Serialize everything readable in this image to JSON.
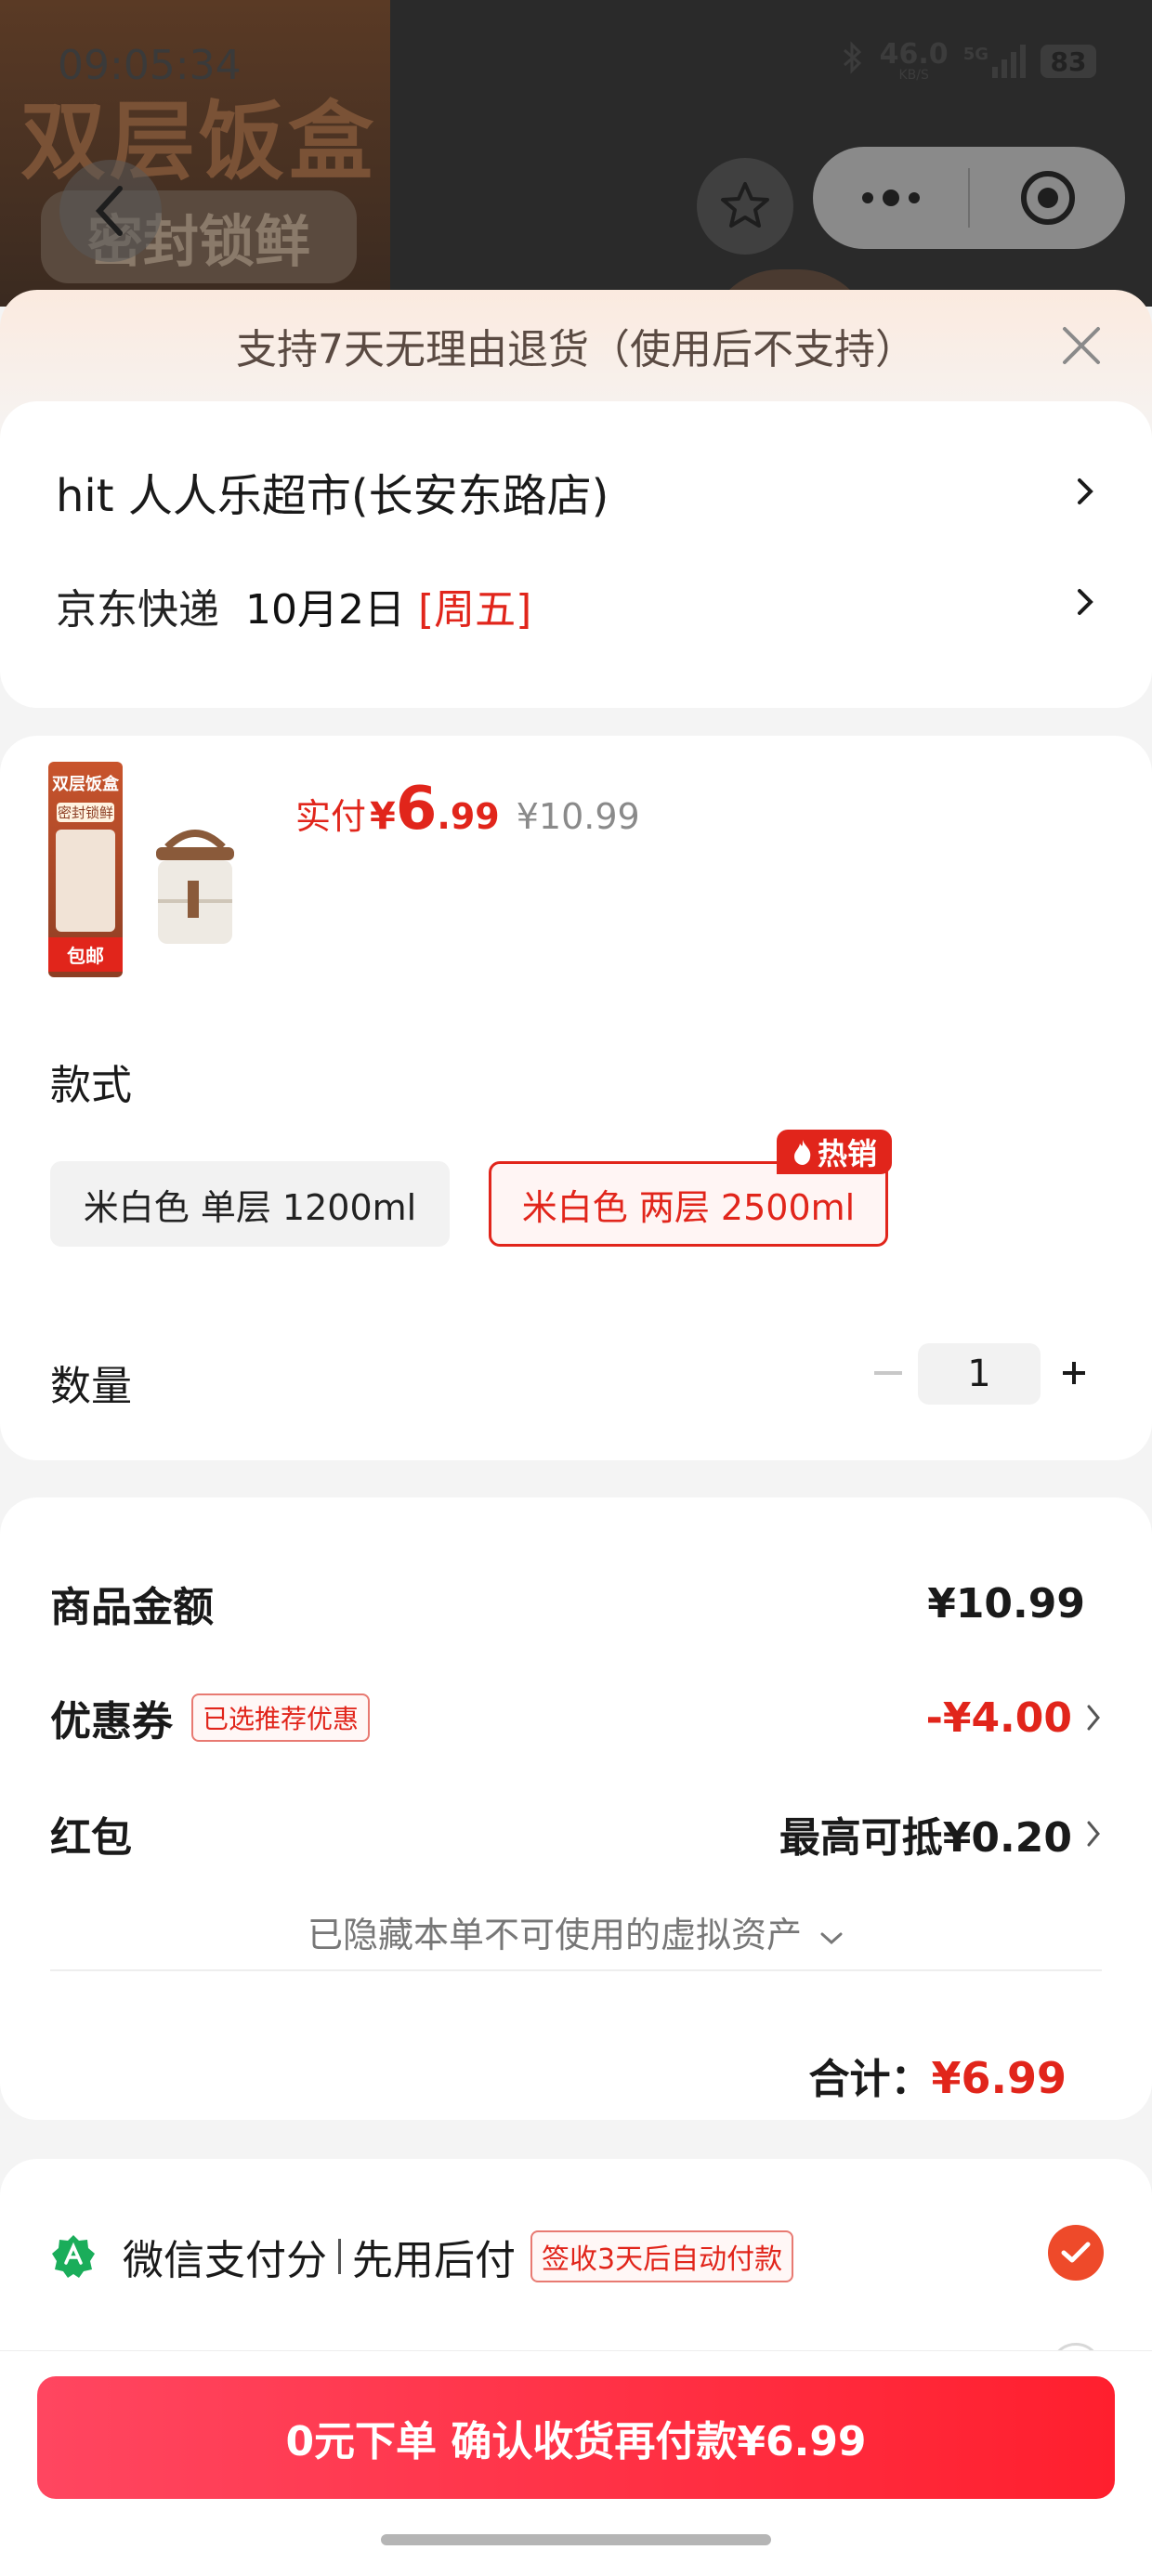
{
  "status_bar": {
    "time": "09:05:34",
    "net_speed": "46.0",
    "net_unit": "KB/S",
    "signal": "5G",
    "battery": "83"
  },
  "background": {
    "product_title": "双层饭盒",
    "product_tag": "密封锁鲜"
  },
  "notice": {
    "text": "支持7天无理由退货（使用后不支持）"
  },
  "address": {
    "store": "hit 人人乐超市(长安东路店)"
  },
  "delivery": {
    "company": "京东快递",
    "date": "10月2日",
    "weekday": "[周五]"
  },
  "product": {
    "thumb_title": "双层饭盒",
    "thumb_tag": "密封锁鲜",
    "thumb_bottom": "包邮",
    "pay_label": "实付",
    "pay_yen": "¥",
    "pay_int": "6",
    "pay_dec": ".99",
    "original_price": "¥10.99"
  },
  "style": {
    "label": "款式",
    "options": [
      {
        "label": "米白色 单层 1200ml",
        "selected": false
      },
      {
        "label": "米白色 两层 2500ml",
        "selected": true
      }
    ],
    "hot_badge": "热销"
  },
  "quantity": {
    "label": "数量",
    "value": "1",
    "minus": "−",
    "plus": "+"
  },
  "summary": {
    "goods_label": "商品金额",
    "goods_value": "¥10.99",
    "coupon_label": "优惠券",
    "coupon_tag": "已选推荐优惠",
    "coupon_value": "-¥4.00",
    "redpacket_label": "红包",
    "redpacket_value": "最高可抵¥0.20",
    "hidden_assets": "已隐藏本单不可使用的虚拟资产",
    "total_label": "合计：",
    "total_value": "¥6.99"
  },
  "payment": {
    "method_part1": "微信支付分",
    "method_part2": "先用后付",
    "method_tag": "签收3天后自动付款"
  },
  "order_button": {
    "label": "0元下单 确认收货再付款¥6.99"
  },
  "colors": {
    "accent": "#e1251b",
    "button_start": "#ff4660",
    "button_end": "#ff1f2e",
    "check": "#ee4a2a"
  }
}
